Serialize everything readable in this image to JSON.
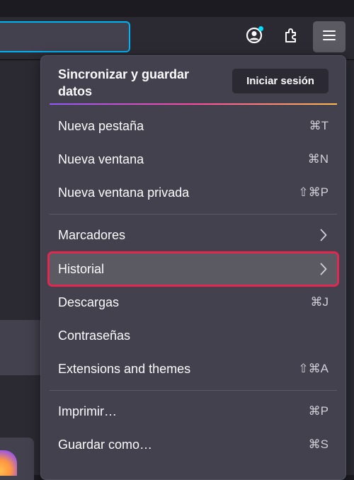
{
  "toolbar": {
    "account_icon": "account-icon",
    "extensions_icon": "puzzle-icon",
    "menu_icon": "hamburger-icon"
  },
  "menu": {
    "sync_heading": "Sincronizar y guardar datos",
    "signin_label": "Iniciar sesión",
    "items": [
      {
        "label": "Nueva pestaña",
        "shortcut": "⌘T"
      },
      {
        "label": "Nueva ventana",
        "shortcut": "⌘N"
      },
      {
        "label": "Nueva ventana privada",
        "shortcut": "⇧⌘P"
      },
      {
        "label": "Marcadores",
        "shortcut": ""
      },
      {
        "label": "Historial",
        "shortcut": ""
      },
      {
        "label": "Descargas",
        "shortcut": "⌘J"
      },
      {
        "label": "Contraseñas",
        "shortcut": ""
      },
      {
        "label": "Extensions and themes",
        "shortcut": "⇧⌘A"
      },
      {
        "label": "Imprimir…",
        "shortcut": "⌘P"
      },
      {
        "label": "Guardar como…",
        "shortcut": "⌘S"
      }
    ]
  },
  "colors": {
    "highlight_outline": "#e22850",
    "urlbar_focus": "#00b3f4"
  }
}
